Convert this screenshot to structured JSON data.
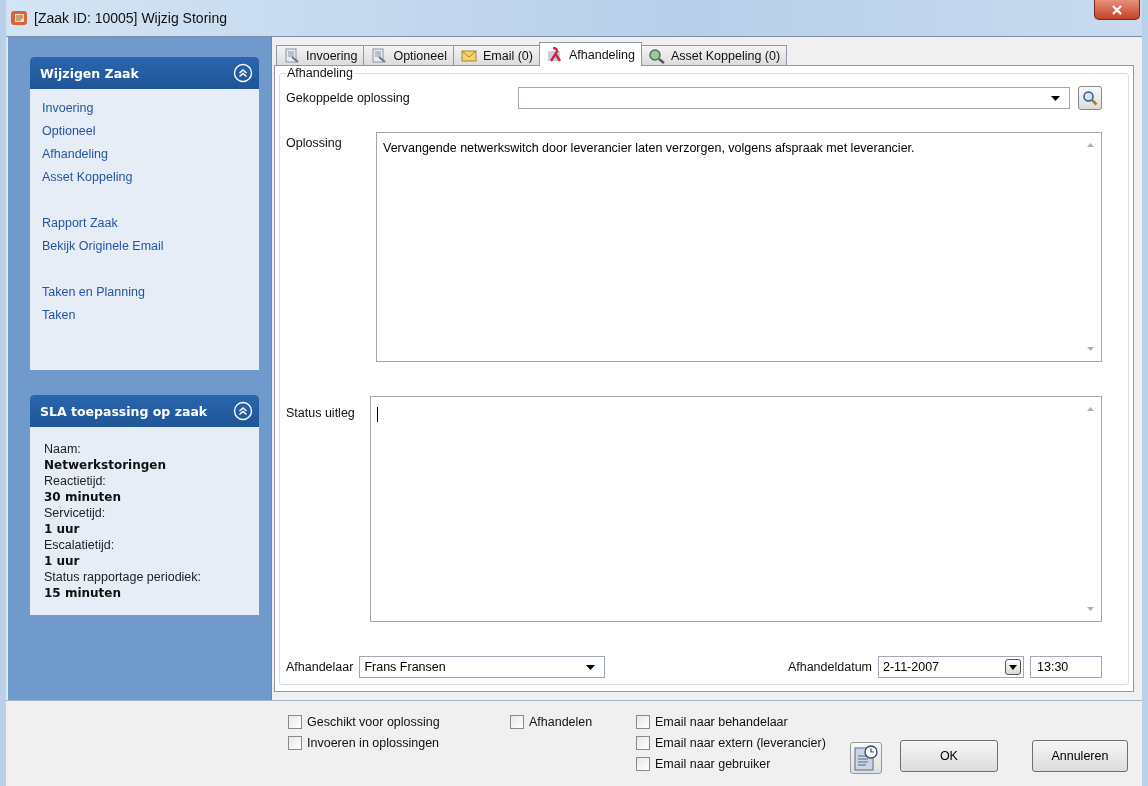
{
  "window": {
    "title": "[Zaak ID: 10005] Wijzig Storing"
  },
  "sidebar": {
    "panels": [
      {
        "kind": "links",
        "title": "Wijzigen Zaak",
        "expanded": true,
        "groups": [
          [
            "Invoering",
            "Optioneel",
            "Afhandeling",
            "Asset Koppeling"
          ],
          [
            "Rapport Zaak",
            "Bekijk Originele Email"
          ],
          [
            "Taken en Planning",
            "Taken"
          ]
        ]
      },
      {
        "kind": "fields",
        "title": "SLA toepassing op zaak",
        "expanded": true,
        "fields": [
          {
            "label": "Naam:",
            "value": "Netwerkstoringen"
          },
          {
            "label": "Reactietijd:",
            "value": "30 minuten"
          },
          {
            "label": "Servicetijd:",
            "value": "1 uur"
          },
          {
            "label": "Escalatietijd:",
            "value": "1 uur"
          },
          {
            "label": "Status rapportage periodiek:",
            "value": "15 minuten"
          }
        ]
      }
    ]
  },
  "tabs": [
    {
      "label": "Invoering",
      "kind": "document",
      "selected": false
    },
    {
      "label": "Optioneel",
      "kind": "document",
      "selected": false
    },
    {
      "label": "Email (0)",
      "kind": "email",
      "selected": false
    },
    {
      "label": "Afhandeling",
      "kind": "handling",
      "selected": true
    },
    {
      "label": "Asset Koppeling (0)",
      "kind": "asset",
      "selected": false
    }
  ],
  "group": {
    "title": "Afhandeling",
    "linked_solution": {
      "label": "Gekoppelde oplossing"
    },
    "solution": {
      "label": "Oplossing",
      "value": "Vervangende netwerkswitch door leverancier laten verzorgen, volgens afspraak met leverancier."
    },
    "status": {
      "label": "Status uitleg"
    },
    "handler": {
      "label": "Afhandelaar",
      "value": "Frans Fransen"
    },
    "date": {
      "label": "Afhandeldatum",
      "value": "2-11-2007",
      "time": "13:30"
    }
  },
  "checkbox_columns": [
    [
      {
        "label": "Geschikt voor oplossing",
        "checked": false
      },
      {
        "label": "Invoeren in oplossingen",
        "checked": false
      }
    ],
    [
      {
        "label": "Afhandelen",
        "checked": false
      }
    ],
    [
      {
        "label": "Email naar behandelaar",
        "checked": false
      },
      {
        "label": "Email naar extern (leverancier)",
        "checked": false
      },
      {
        "label": "Email naar gebruiker",
        "checked": false
      }
    ]
  ],
  "buttons": [
    "OK",
    "Annuleren"
  ]
}
